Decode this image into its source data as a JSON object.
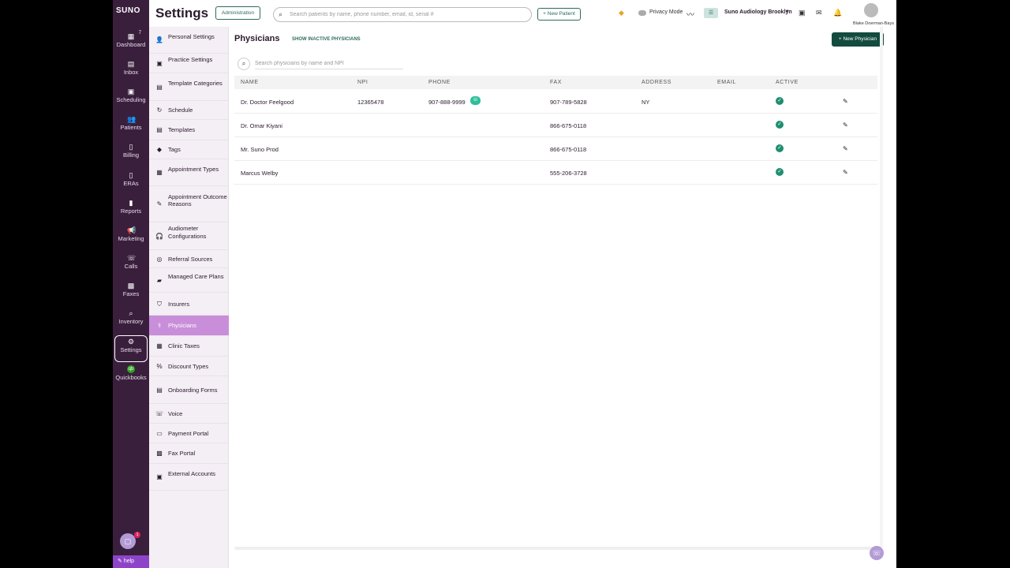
{
  "rail": {
    "logo": "SUNO",
    "dashboard_badge": "7",
    "items": [
      {
        "label": "Dashboard",
        "icon": "▦"
      },
      {
        "label": "Inbox",
        "icon": "▤"
      },
      {
        "label": "Scheduling",
        "icon": "▣"
      },
      {
        "label": "Patients",
        "icon": "👥"
      },
      {
        "label": "Billing",
        "icon": "▯"
      },
      {
        "label": "ERAs",
        "icon": "▯"
      },
      {
        "label": "Reports",
        "icon": "▮"
      },
      {
        "label": "Marketing",
        "icon": "📢"
      },
      {
        "label": "Calls",
        "icon": "☏"
      },
      {
        "label": "Faxes",
        "icon": "▩"
      },
      {
        "label": "Inventory",
        "icon": "⌕"
      },
      {
        "label": "Settings",
        "icon": "⚙"
      },
      {
        "label": "Quickbooks",
        "icon": "qb"
      }
    ],
    "chat_badge": "1",
    "help_label": "help"
  },
  "header": {
    "title": "Settings",
    "admin_label": "Administration",
    "search_placeholder": "Search patients by name, phone number, email, id, serial #",
    "new_patient_label": "+ New Patient",
    "privacy_label": "Privacy Mode",
    "clinic_name": "Suno Audiology Brooklyn",
    "user_name": "Blake Doerman-Bays"
  },
  "settings_nav": [
    {
      "label": "Personal Settings",
      "icon": "👤"
    },
    {
      "label": "Practice Settings",
      "icon": "▣"
    },
    {
      "label": "Template Categories",
      "icon": "▤"
    },
    {
      "label": "Schedule",
      "icon": "↻"
    },
    {
      "label": "Templates",
      "icon": "▤"
    },
    {
      "label": "Tags",
      "icon": "◆"
    },
    {
      "label": "Appointment Types",
      "icon": "▦"
    },
    {
      "label": "Appointment Outcome Reasons",
      "icon": "✎"
    },
    {
      "label": "Audiometer Configurations",
      "icon": "🎧"
    },
    {
      "label": "Referral Sources",
      "icon": "◎"
    },
    {
      "label": "Managed Care Plans",
      "icon": "▰"
    },
    {
      "label": "Insurers",
      "icon": "⛉"
    },
    {
      "label": "Physicians",
      "icon": "⚕"
    },
    {
      "label": "Clinic Taxes",
      "icon": "▦"
    },
    {
      "label": "Discount Types",
      "icon": "%"
    },
    {
      "label": "Onboarding Forms",
      "icon": "▤"
    },
    {
      "label": "Voice",
      "icon": "☏"
    },
    {
      "label": "Payment Portal",
      "icon": "▭"
    },
    {
      "label": "Fax Portal",
      "icon": "▩"
    },
    {
      "label": "External Accounts",
      "icon": "▣"
    }
  ],
  "main": {
    "title": "Physicians",
    "show_inactive_label": "SHOW INACTIVE PHYSICIANS",
    "new_physician_label": "+  New Physician",
    "search_placeholder": "Search physicians by name and NPI",
    "columns": [
      "NAME",
      "NPI",
      "PHONE",
      "FAX",
      "ADDRESS",
      "EMAIL",
      "ACTIVE"
    ],
    "rows": [
      {
        "name": "Dr. Doctor Feelgood",
        "npi": "12365478",
        "phone": "907-888-9999",
        "fax": "907-789-5828",
        "address": "NY",
        "email": "",
        "active": true
      },
      {
        "name": "Dr. Omar Kiyani",
        "npi": "",
        "phone": "",
        "fax": "866-675-0118",
        "address": "",
        "email": "",
        "active": true
      },
      {
        "name": "Mr. Suno Prod",
        "npi": "",
        "phone": "",
        "fax": "866-675-0118",
        "address": "",
        "email": "",
        "active": true
      },
      {
        "name": "Marcus Welby",
        "npi": "",
        "phone": "",
        "fax": "555-206-3728",
        "address": "",
        "email": "",
        "active": true
      }
    ]
  },
  "colors": {
    "rail_bg": "#3a1f3d",
    "accent_green": "#134b3e",
    "active_nav": "#c98ed9",
    "check_green": "#1e8f6e"
  }
}
